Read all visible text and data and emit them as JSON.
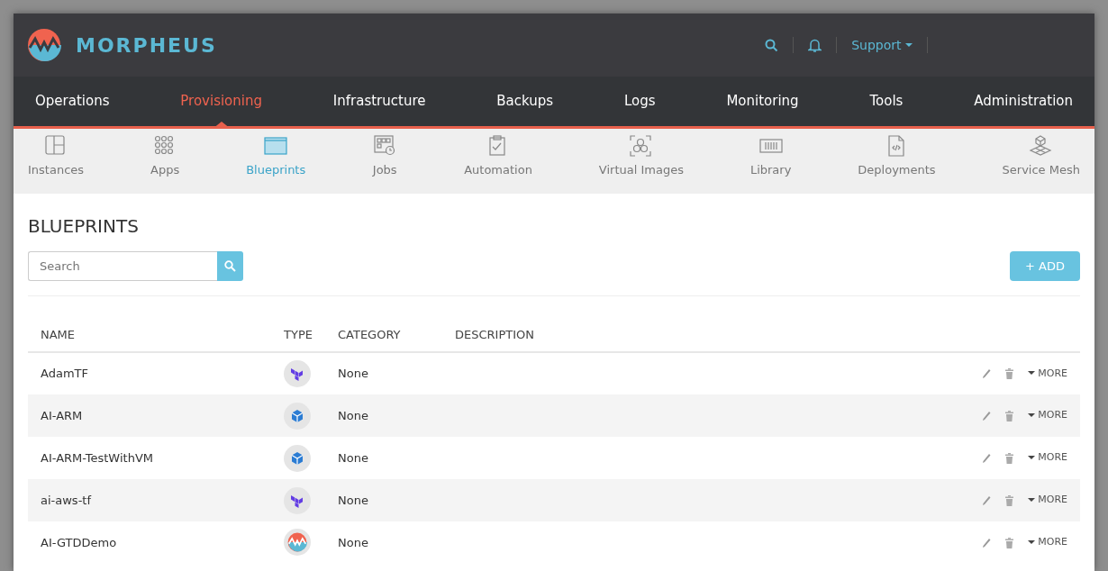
{
  "brand": {
    "name": "MORPHEUS"
  },
  "header_links": [
    {
      "kind": "search"
    },
    {
      "kind": "bell"
    },
    {
      "kind": "menu",
      "label": "Support"
    }
  ],
  "main_nav": [
    {
      "label": "Operations",
      "selected": false
    },
    {
      "label": "Provisioning",
      "selected": true
    },
    {
      "label": "Infrastructure",
      "selected": false
    },
    {
      "label": "Backups",
      "selected": false
    },
    {
      "label": "Logs",
      "selected": false
    },
    {
      "label": "Monitoring",
      "selected": false
    },
    {
      "label": "Tools",
      "selected": false
    },
    {
      "label": "Administration",
      "selected": false
    }
  ],
  "sub_nav": [
    {
      "label": "Instances",
      "kind": "instances",
      "selected": false
    },
    {
      "label": "Apps",
      "kind": "apps",
      "selected": false
    },
    {
      "label": "Blueprints",
      "kind": "blueprints",
      "selected": true
    },
    {
      "label": "Jobs",
      "kind": "jobs",
      "selected": false
    },
    {
      "label": "Automation",
      "kind": "automation",
      "selected": false
    },
    {
      "label": "Virtual Images",
      "kind": "images",
      "selected": false
    },
    {
      "label": "Library",
      "kind": "library",
      "selected": false
    },
    {
      "label": "Deployments",
      "kind": "deployments",
      "selected": false
    },
    {
      "label": "Service Mesh",
      "kind": "mesh",
      "selected": false
    }
  ],
  "page": {
    "title": "BLUEPRINTS",
    "search": {
      "placeholder": "Search"
    },
    "add_button": "+ ADD"
  },
  "table": {
    "columns": [
      "NAME",
      "TYPE",
      "CATEGORY",
      "DESCRIPTION"
    ],
    "rows": [
      {
        "name": "AdamTF",
        "kind": "terraform",
        "category": "None",
        "more": "MORE"
      },
      {
        "name": "AI-ARM",
        "kind": "arm",
        "category": "None",
        "more": "MORE"
      },
      {
        "name": "AI-ARM-TestWithVM",
        "kind": "arm",
        "category": "None",
        "more": "MORE"
      },
      {
        "name": "ai-aws-tf",
        "kind": "terraform",
        "category": "None",
        "more": "MORE"
      },
      {
        "name": "AI-GTDDemo",
        "kind": "morpheus",
        "category": "None",
        "more": "MORE"
      }
    ]
  }
}
